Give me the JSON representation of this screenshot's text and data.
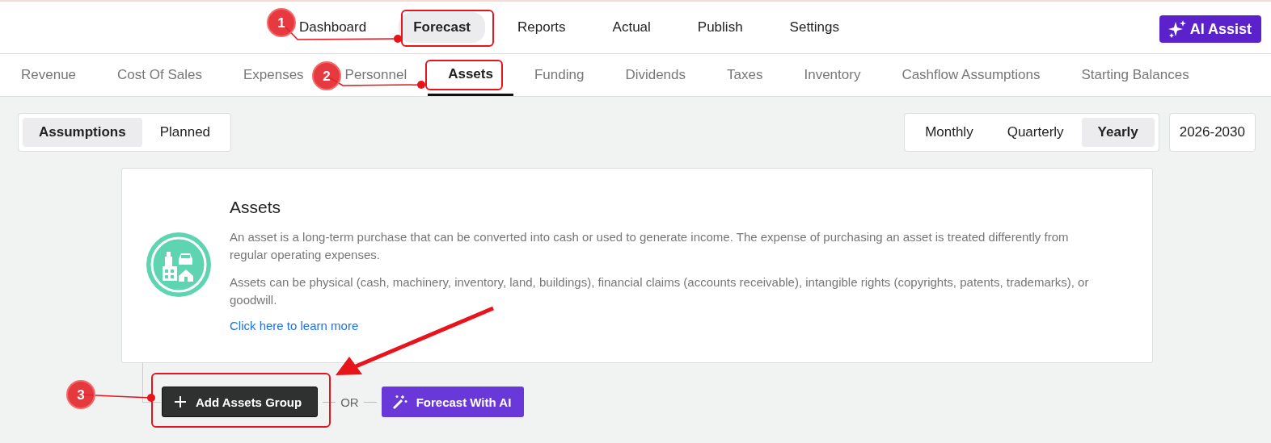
{
  "top_nav": {
    "items": [
      {
        "label": "Dashboard",
        "selected": false
      },
      {
        "label": "Forecast",
        "selected": true
      },
      {
        "label": "Reports",
        "selected": false
      },
      {
        "label": "Actual",
        "selected": false
      },
      {
        "label": "Publish",
        "selected": false
      },
      {
        "label": "Settings",
        "selected": false
      }
    ],
    "ai_button": "AI Assist"
  },
  "sub_tabs": [
    {
      "label": "Revenue",
      "selected": false
    },
    {
      "label": "Cost Of Sales",
      "selected": false
    },
    {
      "label": "Expenses",
      "selected": false
    },
    {
      "label": "Personnel",
      "selected": false
    },
    {
      "label": "Assets",
      "selected": true
    },
    {
      "label": "Funding",
      "selected": false
    },
    {
      "label": "Dividends",
      "selected": false
    },
    {
      "label": "Taxes",
      "selected": false
    },
    {
      "label": "Inventory",
      "selected": false
    },
    {
      "label": "Cashflow Assumptions",
      "selected": false
    },
    {
      "label": "Starting Balances",
      "selected": false
    }
  ],
  "view_toggle": [
    {
      "label": "Assumptions",
      "selected": true
    },
    {
      "label": "Planned",
      "selected": false
    }
  ],
  "period_toggle": [
    {
      "label": "Monthly",
      "selected": false
    },
    {
      "label": "Quarterly",
      "selected": false
    },
    {
      "label": "Yearly",
      "selected": true
    }
  ],
  "date_range": "2026-2030",
  "info_card": {
    "title": "Assets",
    "paragraphs": [
      "An asset is a long-term purchase that can be converted into cash or used to generate income. The expense of purchasing an asset is treated differently from regular operating expenses.",
      "Assets can be physical (cash, machinery, inventory, land, buildings), financial claims (accounts receivable), intangible rights (copyrights, patents, trademarks), or goodwill."
    ],
    "link": "Click here to learn more"
  },
  "actions": {
    "add_button": "Add Assets Group",
    "separator": "OR",
    "ai_button": "Forecast With AI"
  },
  "annotations": [
    {
      "label": "1"
    },
    {
      "label": "2"
    },
    {
      "label": "3"
    }
  ]
}
